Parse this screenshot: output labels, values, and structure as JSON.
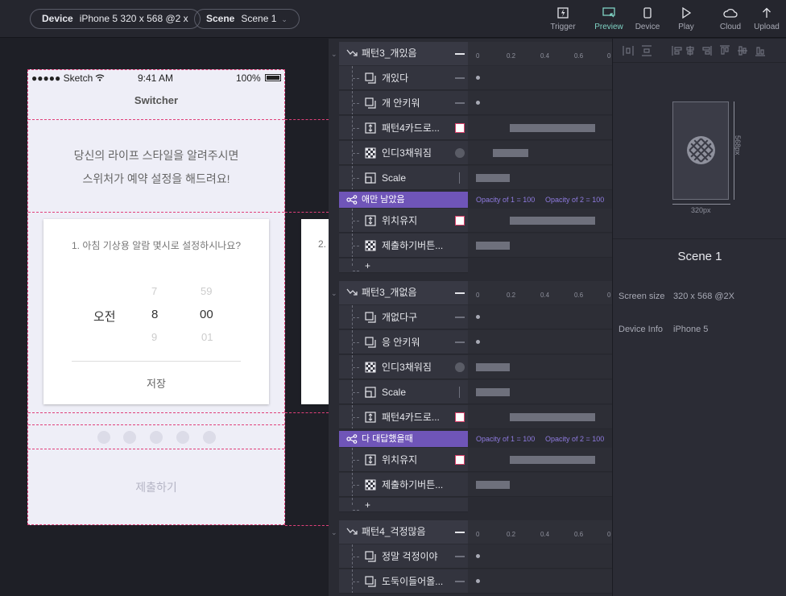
{
  "topbar": {
    "device_label": "Device",
    "device_value": "iPhone 5  320 x 568  @2 x",
    "scene_label": "Scene",
    "scene_value": "Scene 1",
    "buttons": [
      {
        "label": "Trigger",
        "icon": "trigger-icon"
      },
      {
        "label": "Preview",
        "icon": "preview-icon"
      },
      {
        "label": "Device",
        "icon": "device-icon"
      },
      {
        "label": "Play",
        "icon": "play-icon"
      },
      {
        "label": "Cloud",
        "icon": "cloud-icon"
      },
      {
        "label": "Upload",
        "icon": "upload-icon"
      }
    ]
  },
  "phone": {
    "carrier": "●●●●● Sketch",
    "time": "9:41 AM",
    "battery": "100%",
    "title": "Switcher",
    "intro_line1": "당신의 라이프 스타일을 알려주시면",
    "intro_line2": "스위처가 예약 설정을 해드려요!",
    "question": "1. 아침 기상용 알람 몇시로 설정하시나요?",
    "next_card_text": "2.",
    "ampm": "오전",
    "hour_prev": "7",
    "hour": "8",
    "hour_next": "9",
    "min_prev": "59",
    "min": "00",
    "min_next": "01",
    "save": "저장",
    "submit": "제출하기"
  },
  "timeline": {
    "ruler_ticks": [
      "0",
      "0.2",
      "0.4",
      "0.6",
      "0"
    ],
    "groups": [
      {
        "name": "패턴3_개있음",
        "layers": [
          {
            "name": "개있다",
            "icon": "copy-icon"
          },
          {
            "name": "개 안키워",
            "icon": "copy-icon"
          },
          {
            "name": "패턴4카드로...",
            "icon": "position-icon"
          },
          {
            "name": "인디3채워짐",
            "icon": "opacity-icon"
          },
          {
            "name": "Scale",
            "icon": "scale-icon"
          }
        ],
        "condition": "애만 남았음",
        "opacity1": "Opacity of 1 = 100",
        "opacity2": "Opacity of 2 = 100",
        "layers2": [
          {
            "name": "위치유지",
            "icon": "position-icon"
          },
          {
            "name": "제출하기버튼...",
            "icon": "opacity-icon"
          }
        ],
        "add": "+"
      },
      {
        "name": "패턴3_개없음",
        "layers": [
          {
            "name": "개없다구",
            "icon": "copy-icon"
          },
          {
            "name": "응 안키워",
            "icon": "copy-icon"
          },
          {
            "name": "인디3채워짐",
            "icon": "opacity-icon"
          },
          {
            "name": "Scale",
            "icon": "scale-icon"
          },
          {
            "name": "패턴4카드로...",
            "icon": "position-icon"
          }
        ],
        "condition": "다 대답했을때",
        "opacity1": "Opacity of 1 = 100",
        "opacity2": "Opacity of 2 = 100",
        "layers2": [
          {
            "name": "위치유지",
            "icon": "position-icon"
          },
          {
            "name": "제출하기버튼...",
            "icon": "opacity-icon"
          }
        ],
        "add": "+"
      },
      {
        "name": "패턴4_걱정많음",
        "layers": [
          {
            "name": "정말 걱정이야",
            "icon": "copy-icon"
          },
          {
            "name": "도둑이들어올...",
            "icon": "copy-icon"
          }
        ]
      }
    ]
  },
  "properties": {
    "width_label": "320px",
    "height_label": "568px",
    "scene_name": "Scene 1",
    "screen_size_label": "Screen size",
    "screen_size_value": "320 x 568 @2X",
    "device_info_label": "Device Info",
    "device_info_value": "iPhone 5"
  },
  "colors": {
    "accent": "#6f55b8",
    "preview_active": "#7fd3c4",
    "guide": "#e0407a"
  }
}
